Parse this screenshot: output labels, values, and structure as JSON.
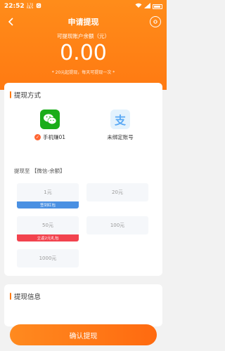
{
  "status_bar": {
    "time": "22:52",
    "speed_value": "1.70",
    "speed_unit": "KB/S"
  },
  "header": {
    "title": "申请提现",
    "balance_label": "可提现账户余额（元）",
    "balance_value": "0.00",
    "note": "* 20元起提现，每天可提现一次 *"
  },
  "withdraw_method": {
    "section_title": "提现方式",
    "methods": [
      {
        "label": "手机赚01",
        "icon": "wechat-icon",
        "selected": true
      },
      {
        "label": "未绑定账号",
        "icon": "alipay-icon",
        "selected": false
      }
    ],
    "target_label": "提现至 【微信-余额】"
  },
  "amount_options": [
    {
      "label": "1元",
      "tag": "签到红包"
    },
    {
      "label": "20元",
      "tag": ""
    },
    {
      "label": "50元",
      "tag": "立返2元礼包"
    },
    {
      "label": "100元",
      "tag": ""
    },
    {
      "label": "1000元",
      "tag": ""
    }
  ],
  "info": {
    "section_title": "提现信息"
  },
  "footer": {
    "confirm_label": "确认提现"
  },
  "colors": {
    "accent": "#ff7a12",
    "wechat": "#1aad19",
    "tag_blue": "#4a90e2",
    "tag_red": "#f2434e"
  }
}
